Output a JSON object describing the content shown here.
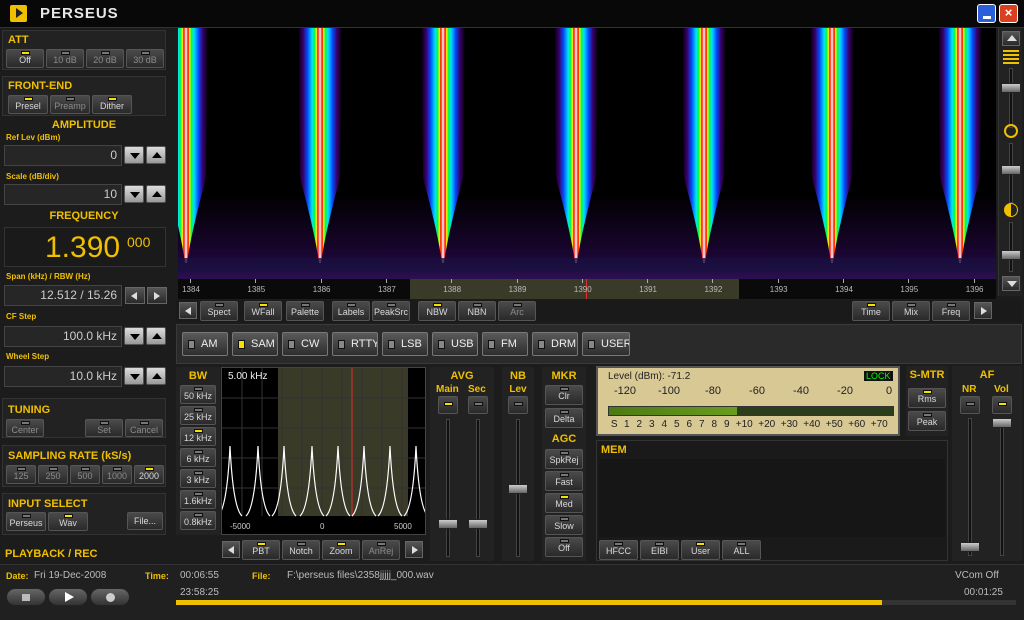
{
  "app": {
    "title": "PERSEUS"
  },
  "window": {
    "minimize_icon": "minimize-icon",
    "close_glyph": "×"
  },
  "att": {
    "title": "ATT",
    "buttons": [
      {
        "label": "Off",
        "on": true
      },
      {
        "label": "10 dB",
        "on": false
      },
      {
        "label": "20 dB",
        "on": false
      },
      {
        "label": "30 dB",
        "on": false
      }
    ]
  },
  "frontend": {
    "title": "FRONT-END",
    "buttons": [
      {
        "label": "Presel",
        "on": true
      },
      {
        "label": "Preamp",
        "on": false
      },
      {
        "label": "Dither",
        "on": true
      }
    ]
  },
  "amplitude": {
    "title": "AMPLITUDE",
    "ref_label": "Ref Lev (dBm)",
    "ref_value": "0",
    "scale_label": "Scale (dB/div)",
    "scale_value": "10"
  },
  "frequency": {
    "title": "FREQUENCY",
    "value_main": "1.390",
    "value_sub": "000",
    "span_label": "Span (kHz) / RBW (Hz)",
    "span_value": "12.512 / 15.26",
    "cfstep_label": "CF Step",
    "cfstep_value": "100.0 kHz",
    "wheel_label": "Wheel Step",
    "wheel_value": "10.0 kHz"
  },
  "tuning": {
    "title": "TUNING",
    "buttons": [
      {
        "label": "Center",
        "on": false
      },
      {
        "label": "Set",
        "on": false
      },
      {
        "label": "Cancel",
        "on": false
      }
    ]
  },
  "sampling": {
    "title": "SAMPLING RATE (kS/s)",
    "buttons": [
      {
        "label": "125",
        "on": false
      },
      {
        "label": "250",
        "on": false
      },
      {
        "label": "500",
        "on": false
      },
      {
        "label": "1000",
        "on": false
      },
      {
        "label": "2000",
        "on": true
      }
    ]
  },
  "input": {
    "title": "INPUT SELECT",
    "buttons": [
      {
        "label": "Perseus",
        "on": false
      },
      {
        "label": "Wav",
        "on": true
      }
    ],
    "file_label": "File..."
  },
  "playback": {
    "title": "PLAYBACK / REC"
  },
  "spectrum": {
    "ticks": [
      "1384",
      "1385",
      "1386",
      "1387",
      "1388",
      "1389",
      "1390",
      "1391",
      "1392",
      "1393",
      "1394",
      "1395",
      "1396"
    ],
    "toolbar_left": [
      {
        "label": "Spect",
        "on": false
      },
      {
        "label": "WFall",
        "on": true
      },
      {
        "label": "Palette",
        "on": false
      },
      {
        "label": "Labels",
        "on": false
      },
      {
        "label": "PeakSrc",
        "on": false
      },
      {
        "label": "NBW",
        "on": true
      },
      {
        "label": "NBN",
        "on": false
      },
      {
        "label": "Arc",
        "on": false
      }
    ],
    "toolbar_right": [
      {
        "label": "Time",
        "on": true
      },
      {
        "label": "Mix",
        "on": false
      },
      {
        "label": "Freq",
        "on": false
      }
    ]
  },
  "modes": [
    {
      "label": "AM",
      "on": false
    },
    {
      "label": "SAM",
      "on": true
    },
    {
      "label": "CW",
      "on": false
    },
    {
      "label": "RTTY",
      "on": false
    },
    {
      "label": "LSB",
      "on": false
    },
    {
      "label": "USB",
      "on": false
    },
    {
      "label": "FM",
      "on": false
    },
    {
      "label": "DRM",
      "on": false
    },
    {
      "label": "USER",
      "on": false
    }
  ],
  "bw": {
    "title": "BW",
    "buttons": [
      {
        "label": "50 kHz",
        "on": false
      },
      {
        "label": "25 kHz",
        "on": false
      },
      {
        "label": "12 kHz",
        "on": true
      },
      {
        "label": "6 kHz",
        "on": false
      },
      {
        "label": "3 kHz",
        "on": false
      },
      {
        "label": "1.6kHz",
        "on": false
      },
      {
        "label": "0.8kHz",
        "on": false
      }
    ]
  },
  "filter": {
    "width_label": "5.00 kHz",
    "xtick_left": "-5000",
    "xtick_mid": "0",
    "xtick_right": "5000",
    "buttons": [
      {
        "label": "PBT",
        "on": true
      },
      {
        "label": "Notch",
        "on": false
      },
      {
        "label": "Zoom",
        "on": true
      },
      {
        "label": "AnRej",
        "on": false
      }
    ]
  },
  "avg": {
    "title": "AVG",
    "main": "Main",
    "sec": "Sec"
  },
  "nb": {
    "title": "NB",
    "sub": "Lev"
  },
  "mkr": {
    "title": "MKR",
    "buttons": [
      {
        "label": "Clr",
        "on": false
      },
      {
        "label": "Delta",
        "on": false
      }
    ]
  },
  "agc": {
    "title": "AGC",
    "buttons": [
      {
        "label": "SpkRej",
        "on": false
      },
      {
        "label": "Fast",
        "on": false
      },
      {
        "label": "Med",
        "on": true
      },
      {
        "label": "Slow",
        "on": false
      },
      {
        "label": "Off",
        "on": false
      }
    ]
  },
  "meter": {
    "level_label": "Level (dBm): -71.2",
    "lock": "LOCK",
    "dbm_scale": [
      "-120",
      "-100",
      "-80",
      "-60",
      "-40",
      "-20",
      "0"
    ],
    "s_scale": [
      "S",
      "1",
      "2",
      "3",
      "4",
      "5",
      "6",
      "7",
      "8",
      "9",
      "+10",
      "+20",
      "+30",
      "+40",
      "+50",
      "+60",
      "+70"
    ],
    "level_fraction": 0.45
  },
  "smtr": {
    "title": "S-MTR",
    "buttons": [
      {
        "label": "Rms",
        "on": true
      },
      {
        "label": "Peak",
        "on": false
      }
    ]
  },
  "af": {
    "title": "AF",
    "nr": "NR",
    "vol": "Vol"
  },
  "mem": {
    "title": "MEM",
    "buttons": [
      {
        "label": "HFCC",
        "on": false
      },
      {
        "label": "EIBI",
        "on": false
      },
      {
        "label": "User",
        "on": true
      },
      {
        "label": "ALL",
        "on": false
      }
    ]
  },
  "status": {
    "date_label": "Date:",
    "date_value": "Fri 19-Dec-2008",
    "time_label": "Time:",
    "time_value": "00:06:55",
    "file_label": "File:",
    "file_value": "F:\\perseus files\\2358jjjjj_000.wav",
    "vcom": "VCom Off",
    "pos_start": "23:58:25",
    "pos_end": "00:01:25",
    "progress_fraction": 0.84
  }
}
